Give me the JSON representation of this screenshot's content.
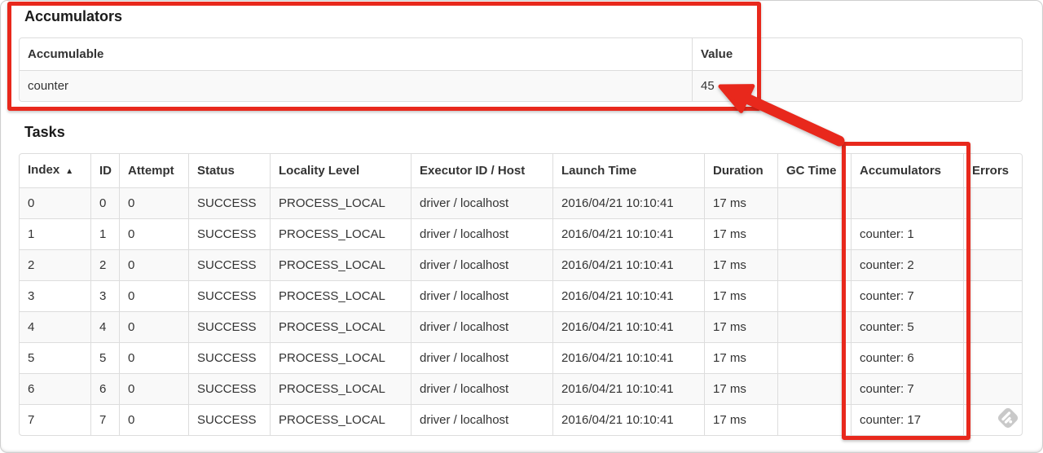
{
  "theme": {
    "annotation-red": "#e8281c",
    "table-border": "#dddddd",
    "stripe-bg": "#f9f9f9",
    "text-color": "#333333"
  },
  "accumulators_section": {
    "title": "Accumulators",
    "table": {
      "headers": [
        "Accumulable",
        "Value"
      ],
      "rows": [
        {
          "accumulable": "counter",
          "value": "45"
        }
      ]
    }
  },
  "tasks_section": {
    "title": "Tasks",
    "table": {
      "headers": [
        "Index",
        "ID",
        "Attempt",
        "Status",
        "Locality Level",
        "Executor ID / Host",
        "Launch Time",
        "Duration",
        "GC Time",
        "Accumulators",
        "Errors"
      ],
      "sort": {
        "column": "Index",
        "direction": "ascending",
        "icon": "▲"
      },
      "rows": [
        [
          "0",
          "0",
          "0",
          "SUCCESS",
          "PROCESS_LOCAL",
          "driver / localhost",
          "2016/04/21 10:10:41",
          "17 ms",
          "",
          "",
          ""
        ],
        [
          "1",
          "1",
          "0",
          "SUCCESS",
          "PROCESS_LOCAL",
          "driver / localhost",
          "2016/04/21 10:10:41",
          "17 ms",
          "",
          "counter: 1",
          ""
        ],
        [
          "2",
          "2",
          "0",
          "SUCCESS",
          "PROCESS_LOCAL",
          "driver / localhost",
          "2016/04/21 10:10:41",
          "17 ms",
          "",
          "counter: 2",
          ""
        ],
        [
          "3",
          "3",
          "0",
          "SUCCESS",
          "PROCESS_LOCAL",
          "driver / localhost",
          "2016/04/21 10:10:41",
          "17 ms",
          "",
          "counter: 7",
          ""
        ],
        [
          "4",
          "4",
          "0",
          "SUCCESS",
          "PROCESS_LOCAL",
          "driver / localhost",
          "2016/04/21 10:10:41",
          "17 ms",
          "",
          "counter: 5",
          ""
        ],
        [
          "5",
          "5",
          "0",
          "SUCCESS",
          "PROCESS_LOCAL",
          "driver / localhost",
          "2016/04/21 10:10:41",
          "17 ms",
          "",
          "counter: 6",
          ""
        ],
        [
          "6",
          "6",
          "0",
          "SUCCESS",
          "PROCESS_LOCAL",
          "driver / localhost",
          "2016/04/21 10:10:41",
          "17 ms",
          "",
          "counter: 7",
          ""
        ],
        [
          "7",
          "7",
          "0",
          "SUCCESS",
          "PROCESS_LOCAL",
          "driver / localhost",
          "2016/04/21 10:10:41",
          "17 ms",
          "",
          "counter: 17",
          ""
        ]
      ]
    }
  },
  "annotations": {
    "highlight_color": "#e8281c",
    "accumulators_box": "red highlight around Accumulators summary",
    "accumulators_column_box": "red highlight around Accumulators task column",
    "arrow": "red arrow pointing from Accumulators column to value 45",
    "watermark_icon": "annotation-stamp-icon"
  }
}
